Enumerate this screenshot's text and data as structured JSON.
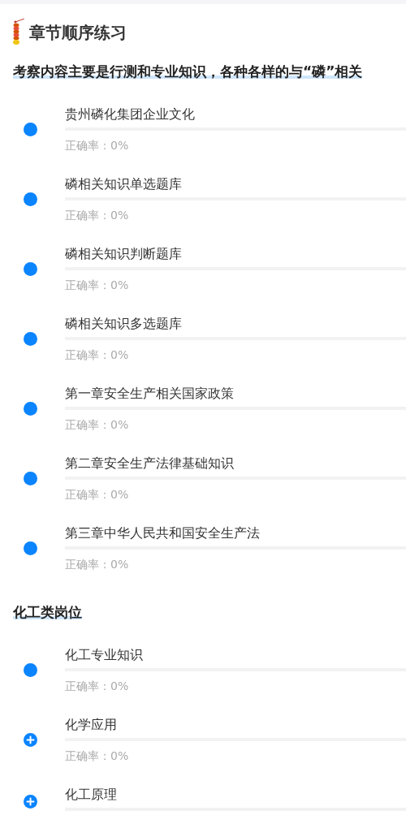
{
  "page_title": "章节顺序练习",
  "sections": [
    {
      "heading": "考察内容主要是行测和专业知识，各种各样的与“磷”相关",
      "items": [
        {
          "kind": "dot",
          "title": "贵州磷化集团企业文化",
          "level": 0,
          "rate": "正确率：0%"
        },
        {
          "kind": "dot",
          "title": "磷相关知识单选题库",
          "level": 0,
          "rate": "正确率：0%"
        },
        {
          "kind": "dot",
          "title": "磷相关知识判断题库",
          "level": 0,
          "rate": "正确率：0%"
        },
        {
          "kind": "dot",
          "title": "磷相关知识多选题库",
          "level": 0,
          "rate": "正确率：0%"
        },
        {
          "kind": "dot",
          "title": "第一章安全生产相关国家政策",
          "level": 0,
          "rate": "正确率：0%"
        },
        {
          "kind": "dot",
          "title": "第二章安全生产法律基础知识",
          "level": 0,
          "rate": "正确率：0%"
        },
        {
          "kind": "dot",
          "title": "第三章中华人民共和国安全生产法",
          "level": 0,
          "rate": "正确率：0%"
        }
      ]
    },
    {
      "heading": "化工类岗位",
      "items": [
        {
          "kind": "dot",
          "title": "化工专业知识",
          "level": 0,
          "rate": "正确率：0%"
        },
        {
          "kind": "expand",
          "title": "化学应用",
          "level": 0,
          "rate": "正确率：0%"
        },
        {
          "kind": "expand",
          "title": "化工原理",
          "level": 0
        }
      ]
    }
  ]
}
